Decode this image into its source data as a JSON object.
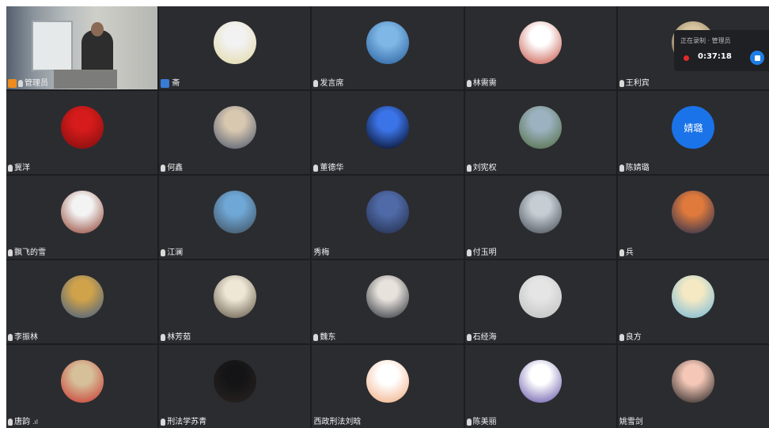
{
  "recording": {
    "subtitle": "正在录制 · 管理员",
    "elapsed": "0:37:18"
  },
  "tiles": [
    {
      "name": "管理员",
      "kind": "video",
      "host": true,
      "mic": true
    },
    {
      "name": "斋",
      "kind": "avatar",
      "user_icon": true,
      "mic": false,
      "colors": [
        "#f2f2f2",
        "#e2d7a3"
      ]
    },
    {
      "name": "发言席",
      "kind": "avatar",
      "mic": true,
      "colors": [
        "#7fb7e6",
        "#245b9a"
      ]
    },
    {
      "name": "林需需",
      "kind": "avatar",
      "mic": true,
      "colors": [
        "#ffffff",
        "#c24a3b"
      ]
    },
    {
      "name": "王利宾",
      "kind": "avatar",
      "mic": true,
      "colors": [
        "#d7c5a0",
        "#6a5a40"
      ]
    },
    {
      "name": "冀洋",
      "kind": "avatar",
      "mic": true,
      "colors": [
        "#d51b1b",
        "#7a0d0d"
      ]
    },
    {
      "name": "何鑫",
      "kind": "avatar",
      "mic": true,
      "colors": [
        "#d9c8b0",
        "#45536b"
      ]
    },
    {
      "name": "董德华",
      "kind": "avatar",
      "mic": true,
      "colors": [
        "#3b74e8",
        "#03030f"
      ]
    },
    {
      "name": "刘宪权",
      "kind": "avatar",
      "mic": true,
      "colors": [
        "#9db2c1",
        "#4c6a3c"
      ]
    },
    {
      "name": "陈婧璐",
      "kind": "text",
      "mic": true,
      "avatar_text": "婧璐",
      "colors": [
        "#1a73e8",
        "#1a73e8"
      ]
    },
    {
      "name": "飘飞的雪",
      "kind": "avatar",
      "mic": true,
      "colors": [
        "#f3f3f3",
        "#8c3a2a"
      ]
    },
    {
      "name": "江澜",
      "kind": "avatar",
      "mic": true,
      "colors": [
        "#6fa7d6",
        "#3d4a55"
      ]
    },
    {
      "name": "秀梅",
      "kind": "avatar",
      "mic": false,
      "colors": [
        "#506aa8",
        "#1f2a44"
      ]
    },
    {
      "name": "付玉明",
      "kind": "avatar",
      "mic": true,
      "colors": [
        "#c6cdd3",
        "#3e4650"
      ]
    },
    {
      "name": "兵",
      "kind": "avatar",
      "mic": true,
      "colors": [
        "#e07a3c",
        "#1b2b52"
      ]
    },
    {
      "name": "李振林",
      "kind": "avatar",
      "mic": true,
      "colors": [
        "#d0a34a",
        "#3b5a88"
      ]
    },
    {
      "name": "林芳茹",
      "kind": "avatar",
      "mic": true,
      "colors": [
        "#efe7d5",
        "#5a5140"
      ]
    },
    {
      "name": "魏东",
      "kind": "avatar",
      "mic": true,
      "colors": [
        "#e8e2dc",
        "#222831"
      ]
    },
    {
      "name": "石经海",
      "kind": "avatar",
      "mic": true,
      "colors": [
        "#e5e5e5",
        "#bdbdbd"
      ]
    },
    {
      "name": "良方",
      "kind": "avatar",
      "mic": true,
      "colors": [
        "#f5e9c4",
        "#6fb7d9"
      ]
    },
    {
      "name": "唐韵",
      "kind": "avatar",
      "mic": true,
      "signal": ".ıl",
      "colors": [
        "#d6c09a",
        "#c9312a"
      ]
    },
    {
      "name": "刑法学苏青",
      "kind": "avatar",
      "mic": true,
      "colors": [
        "#141416",
        "#2a2420"
      ]
    },
    {
      "name": "西政刑法刘晗",
      "kind": "avatar",
      "mic": false,
      "colors": [
        "#ffffff",
        "#f0a77a"
      ]
    },
    {
      "name": "陈美丽",
      "kind": "avatar",
      "mic": true,
      "colors": [
        "#ffffff",
        "#5b4aa3"
      ]
    },
    {
      "name": "姚雪剑",
      "kind": "avatar",
      "mic": false,
      "colors": [
        "#f4c7b7",
        "#1a1a1a"
      ]
    }
  ]
}
